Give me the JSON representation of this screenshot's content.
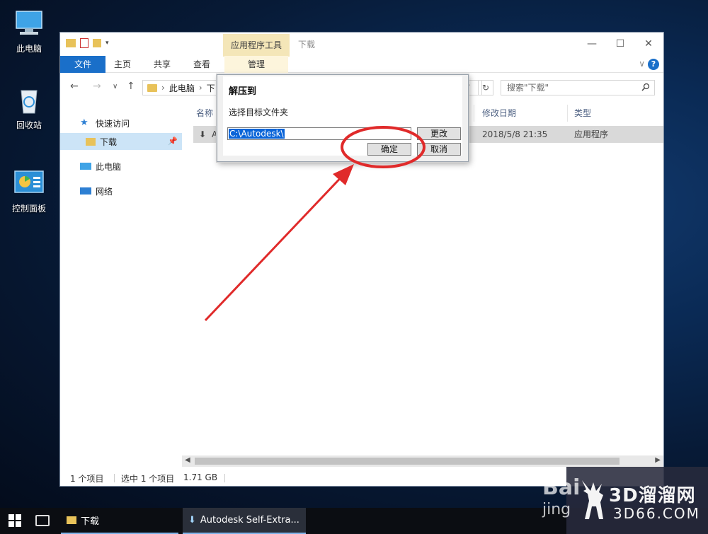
{
  "desktop": {
    "icons": [
      {
        "label": "此电脑"
      },
      {
        "label": "回收站"
      },
      {
        "label": "控制面板"
      }
    ]
  },
  "window": {
    "title": "下载",
    "context_tab": "应用程序工具",
    "ribbon_tabs": [
      "文件",
      "主页",
      "共享",
      "查看",
      "管理"
    ],
    "address": {
      "part1": "此电脑",
      "part2": "下"
    },
    "search_placeholder": "搜索\"下载\"",
    "nav_items": [
      {
        "label": "快速访问"
      },
      {
        "label": "下载"
      },
      {
        "label": "此电脑"
      },
      {
        "label": "网络"
      }
    ],
    "columns": {
      "name": "名称",
      "date": "修改日期",
      "type": "类型"
    },
    "file": {
      "name": "A",
      "date": "2018/5/8 21:35",
      "type": "应用程序"
    },
    "status": {
      "count": "1 个项目",
      "selected": "选中 1 个项目",
      "size": "1.71 GB"
    }
  },
  "dialog": {
    "title": "解压到",
    "prompt": "选择目标文件夹",
    "path_value": "C:\\Autodesk\\",
    "change_label": "更改",
    "ok_label": "确定",
    "cancel_label": "取消"
  },
  "taskbar": {
    "items": [
      {
        "label": "下载"
      },
      {
        "label": "Autodesk Self-Extra..."
      }
    ]
  },
  "watermark": {
    "baidu": "Bai",
    "jing": "jing",
    "site": "3D溜溜网",
    "sub": "3D66.COM"
  },
  "colors": {
    "accent": "#1a6fc9",
    "annotation": "#e02a2a",
    "selection": "#0a64d8"
  }
}
